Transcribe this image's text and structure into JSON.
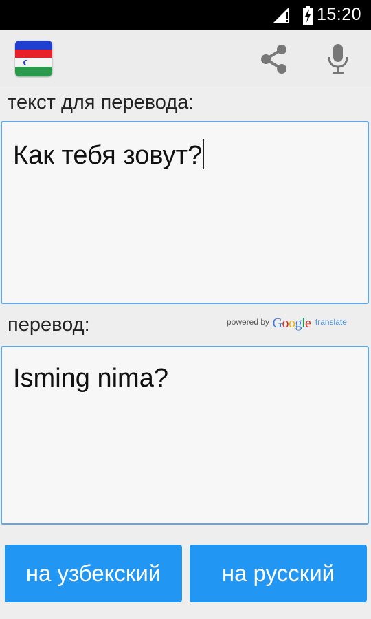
{
  "status_bar": {
    "time": "15:20",
    "icons": [
      "signal-icon",
      "battery-charging-icon"
    ]
  },
  "action_bar": {
    "icons": [
      "uzbekistan-flag-icon",
      "share-icon",
      "microphone-icon"
    ],
    "flag_colors": [
      "#1e3fcf",
      "#e8202a",
      "#f4f4f4",
      "#2a9a4c"
    ]
  },
  "source": {
    "label": "текст для перевода:",
    "text": "Как тебя зовут?"
  },
  "target": {
    "label": "перевод:",
    "text": "Isming nima?",
    "powered_by": "powered by",
    "google": [
      "G",
      "o",
      "o",
      "g",
      "l",
      "e"
    ],
    "translate": "translate"
  },
  "buttons": {
    "to_uzbek": "на узбекский",
    "to_russian": "на русский"
  },
  "colors": {
    "accent": "#2196f3",
    "field_border": "#64a6e4"
  }
}
